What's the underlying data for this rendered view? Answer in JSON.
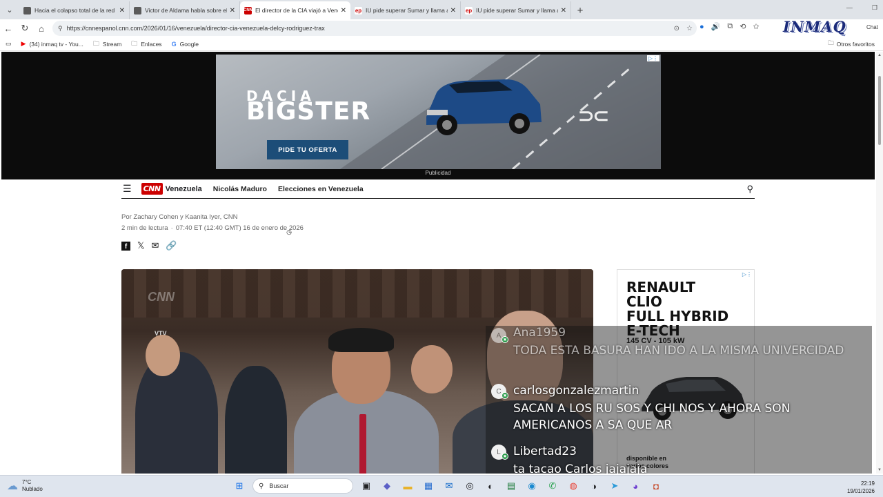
{
  "browser": {
    "tabs": [
      {
        "title": "Hacia el colapso total de la red elé",
        "fav_color": "#5a5a5a",
        "fav_glyph": ""
      },
      {
        "title": "Victor de Aldama habla sobre el h",
        "fav_color": "#5a5a5a",
        "fav_glyph": ""
      },
      {
        "title": "El director de la CIA viajó a Venez",
        "fav_color": "#cc0000",
        "fav_glyph": "CNN",
        "active": true
      },
      {
        "title": "IU pide superar Sumar y llama a a",
        "fav_color": "#ffffff",
        "fav_glyph": "ep"
      },
      {
        "title": "IU pide superar Sumar y llama a a",
        "fav_color": "#ffffff",
        "fav_glyph": "ep"
      }
    ],
    "url": "https://cnnespanol.cnn.com/2026/01/16/venezuela/director-cia-venezuela-delcy-rodriguez-trax",
    "logo_text": "INMAQ",
    "chat_label": "Chat",
    "bookmarks": [
      {
        "label": "(34) inmaq tv - You...",
        "icon": "youtube-icon"
      },
      {
        "label": "Stream",
        "icon": "folder-icon"
      },
      {
        "label": "Enlaces",
        "icon": "folder-icon"
      },
      {
        "label": "Google",
        "icon": "google-icon"
      }
    ],
    "other_favorites": "Otros favoritos"
  },
  "top_ad": {
    "brand_line1": "DACIA",
    "brand_line2": "BIGSTER",
    "cta": "PIDE TU OFERTA",
    "label": "Publicidad"
  },
  "nav": {
    "section": "Venezuela",
    "links": [
      "Nicolás Maduro",
      "Elecciones en Venezuela"
    ],
    "logo": "CNN"
  },
  "article": {
    "byline": "Por Zachary Cohen y Kaanita Iyer, CNN",
    "read_time": "2 min de lectura",
    "timestamp": "07:40 ET (12:40 GMT) 16 de enero de 2026"
  },
  "video": {
    "watermark": "CNN",
    "channel": "VTV"
  },
  "side_ad": {
    "line1": "RENAULT",
    "line2": "CLIO",
    "line3": "FULL HYBRID",
    "line4": "E-TECH",
    "spec": "145 CV - 105 kW",
    "avail1": "disponible en",
    "avail2": "varios colores"
  },
  "chat": {
    "messages": [
      {
        "user": "Ana1959",
        "initial": "A",
        "text": "TODA ESTA BASURA HAN IDO A LA MISMA UNIVERCIDAD"
      },
      {
        "user": "carlosgonzalezmartin",
        "initial": "C",
        "text": "SACAN A LOS RU SOS Y CHI NOS Y AHORA SON AMERICANOS A SA QUE AR"
      },
      {
        "user": "Libertad23",
        "initial": "L",
        "text": "ta tacao Carlos jajajaja"
      }
    ]
  },
  "taskbar": {
    "temp": "7°C",
    "condition": "Nublado",
    "search_placeholder": "Buscar",
    "time": "22:19",
    "date": "19/01/2026"
  }
}
